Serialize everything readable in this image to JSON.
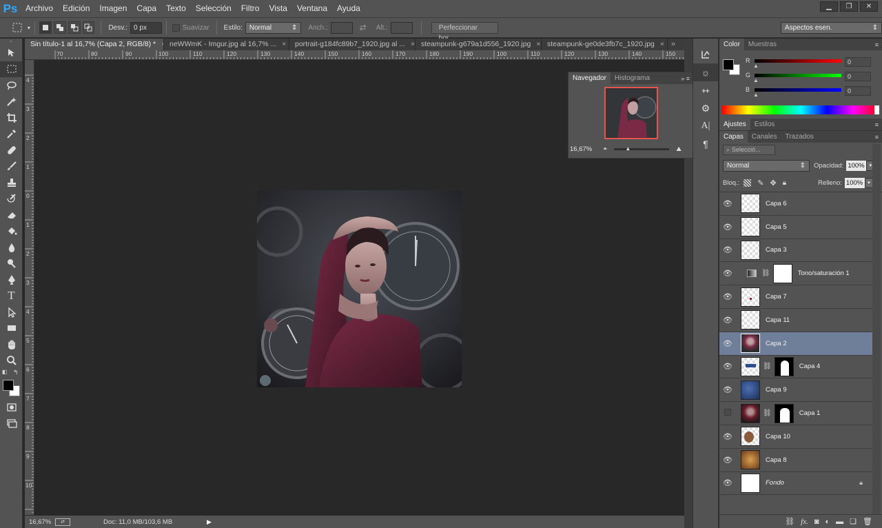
{
  "app": {
    "logo": "Ps"
  },
  "menu": [
    "Archivo",
    "Edición",
    "Imagen",
    "Capa",
    "Texto",
    "Selección",
    "Filtro",
    "Vista",
    "Ventana",
    "Ayuda"
  ],
  "options": {
    "feather_label": "Desv.:",
    "feather_value": "0 px",
    "antialias_label": "Suavizar",
    "style_label": "Estilo:",
    "style_value": "Normal",
    "width_label": "Anch.:",
    "height_label": "Alt.:",
    "refine_button": "Perfeccionar bor.",
    "workspace": "Aspectos esen."
  },
  "tabs": [
    {
      "label": "Sin título-1 al 16,7% (Capa 2, RGB/8) *"
    },
    {
      "label": "neWWmK - Imgur.jpg al 16,7% ..."
    },
    {
      "label": "portrait-g184fc89b7_1920.jpg al ..."
    },
    {
      "label": "steampunk-g679a1d556_1920.jpg"
    },
    {
      "label": "steampunk-ge0de3fb7c_1920.jpg"
    }
  ],
  "ruler_top": [
    "70",
    "80",
    "90",
    "100",
    "110",
    "120",
    "130",
    "140",
    "150",
    "160",
    "170",
    "180",
    "190",
    "100",
    "110",
    "120",
    "130",
    "140",
    "150"
  ],
  "ruler_left": [
    "4",
    "3",
    "2",
    "1",
    "0",
    "1",
    "2",
    "3",
    "4",
    "5",
    "6",
    "7",
    "8",
    "9",
    "10"
  ],
  "status": {
    "zoom": "16,67%",
    "doc": "Doc: 11,0 MB/103,6 MB"
  },
  "navigator": {
    "tab1": "Navegador",
    "tab2": "Histograma",
    "zoom": "16,67%"
  },
  "color_panel": {
    "tab1": "Color",
    "tab2": "Muestras",
    "channels": [
      {
        "label": "R",
        "value": "0"
      },
      {
        "label": "G",
        "value": "0"
      },
      {
        "label": "B",
        "value": "0"
      }
    ]
  },
  "adjust_panel": {
    "tab1": "Ajustes",
    "tab2": "Estilos"
  },
  "layers_panel": {
    "tabs": [
      "Capas",
      "Canales",
      "Trazados"
    ],
    "filter_placeholder": "Selecció...",
    "blend_mode": "Normal",
    "opacity_label": "Opacidad:",
    "opacity_value": "100%",
    "lock_label": "Bloq.:",
    "fill_label": "Relleno:",
    "fill_value": "100%",
    "layers": [
      {
        "name": "Capa 6"
      },
      {
        "name": "Capa 5"
      },
      {
        "name": "Capa 3"
      },
      {
        "name": "Tono/saturación 1"
      },
      {
        "name": "Capa 7"
      },
      {
        "name": "Capa 11"
      },
      {
        "name": "Capa 2"
      },
      {
        "name": "Capa 4"
      },
      {
        "name": "Capa 9"
      },
      {
        "name": "Capa 1"
      },
      {
        "name": "Capa 10"
      },
      {
        "name": "Capa 8"
      },
      {
        "name": "Fondo"
      }
    ]
  }
}
